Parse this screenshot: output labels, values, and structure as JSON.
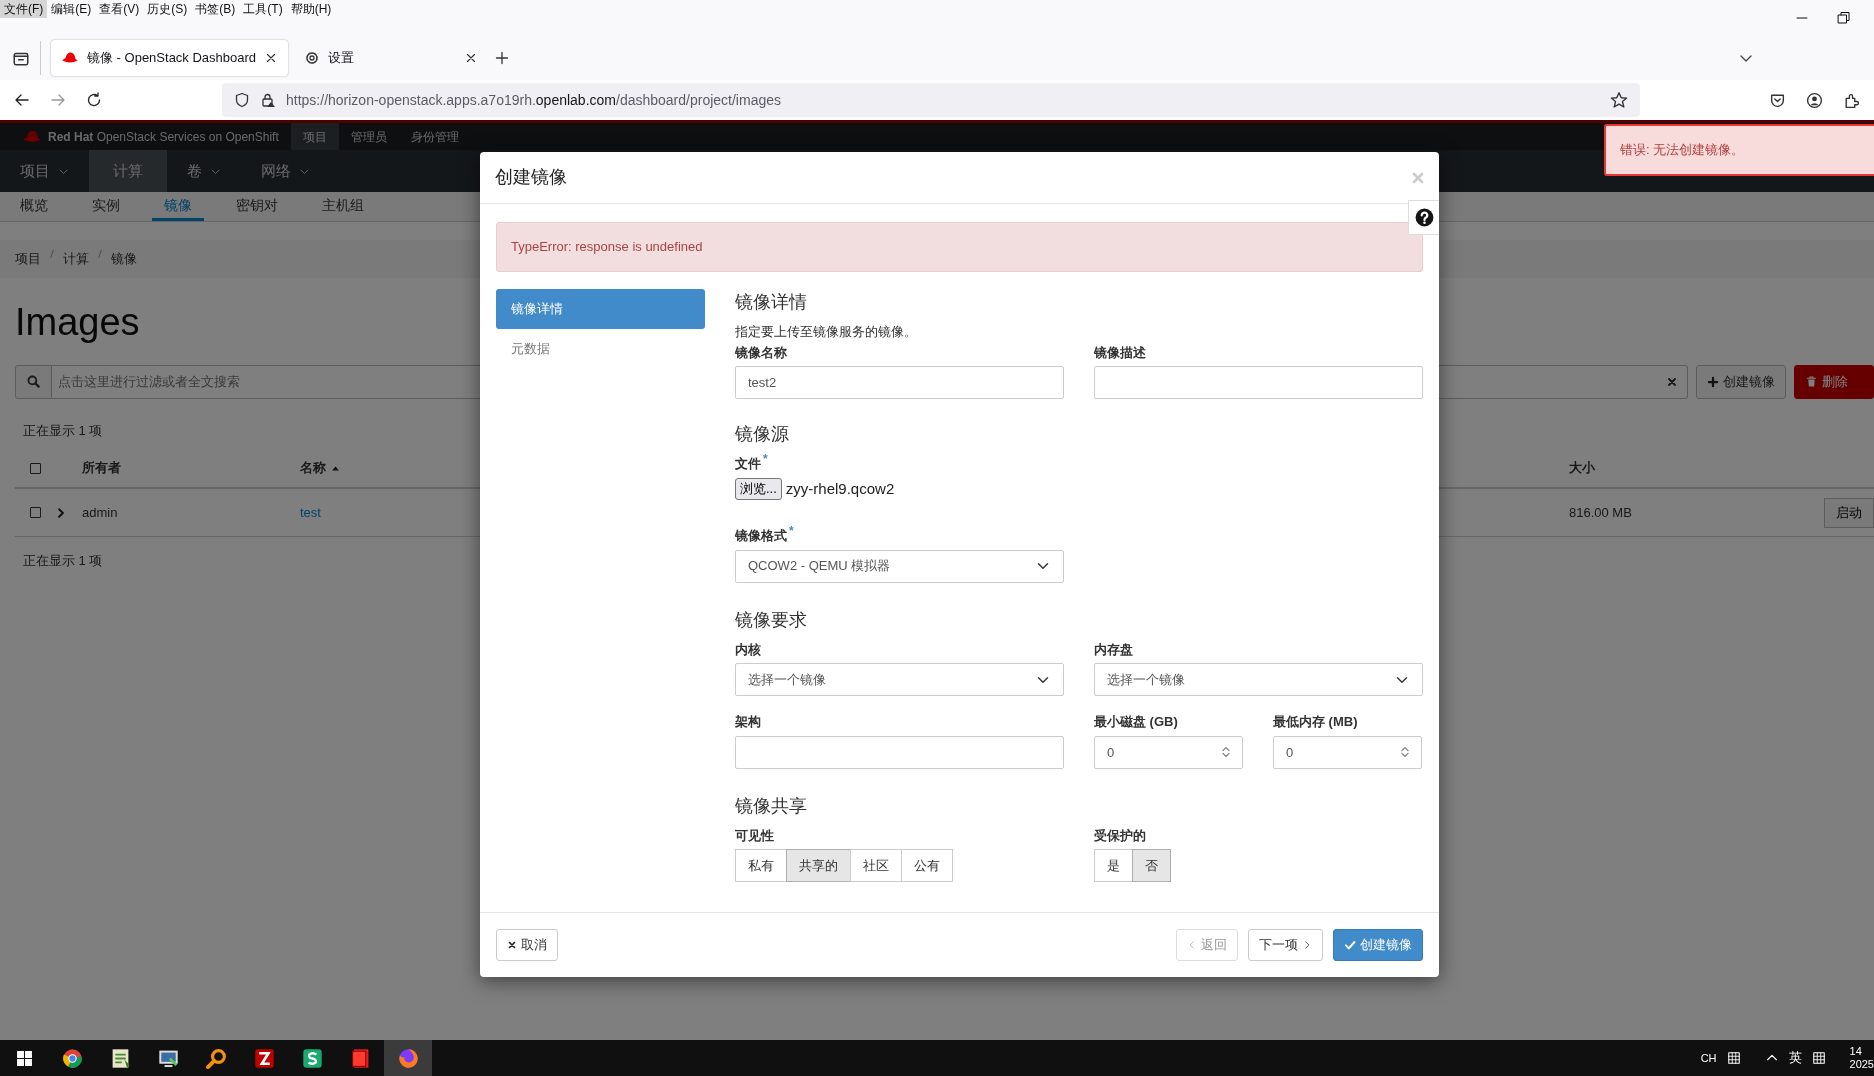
{
  "menu_bar": [
    {
      "label": "文件(F)",
      "selected": true
    },
    {
      "label": "编辑(E)",
      "selected": false
    },
    {
      "label": "查看(V)",
      "selected": false
    },
    {
      "label": "历史(S)",
      "selected": false
    },
    {
      "label": "书签(B)",
      "selected": false
    },
    {
      "label": "工具(T)",
      "selected": false
    },
    {
      "label": "帮助(H)",
      "selected": false
    }
  ],
  "browser_tabs": [
    {
      "kind": "site",
      "title": "镜像 - OpenStack Dashboard",
      "selected": true
    },
    {
      "kind": "settings",
      "title": "设置",
      "selected": false
    }
  ],
  "address": {
    "url_start": "https://horizon-openstack.apps.a7o19rh.",
    "url_domain": "openlab.com",
    "url_path": "/dashboard/project/images"
  },
  "brand": "**Red Hat** OpenStack Services on OpenShift",
  "top_nav": [
    {
      "label": "项目",
      "selected": true
    },
    {
      "label": "管理员",
      "selected": false
    },
    {
      "label": "身份管理",
      "selected": false
    }
  ],
  "section_nav": [
    {
      "label": "项目",
      "dropdown": true,
      "selected": false
    },
    {
      "label": "计算",
      "dropdown": false,
      "selected": true
    },
    {
      "label": "卷",
      "dropdown": true,
      "selected": false
    },
    {
      "label": "网络",
      "dropdown": true,
      "selected": false
    }
  ],
  "sub_nav": [
    {
      "label": "概览",
      "selected": false
    },
    {
      "label": "实例",
      "selected": false
    },
    {
      "label": "镜像",
      "selected": true
    },
    {
      "label": "密钥对",
      "selected": false
    },
    {
      "label": "主机组",
      "selected": false
    }
  ],
  "breadcrumb": [
    "项目",
    "计算",
    "镜像"
  ],
  "page_title": "Images",
  "filter": {
    "placeholder": "点击这里进行过滤或者全文搜索"
  },
  "actions": [
    {
      "kind": "create",
      "label": "创建镜像"
    },
    {
      "kind": "delete",
      "label": "删除"
    }
  ],
  "table": {
    "count_top": "正在显示 1 项",
    "select_all_checked": false,
    "columns": [
      {
        "label": "所有者",
        "sorted": false
      },
      {
        "label": "名称",
        "sorted": true
      },
      {
        "label": "大小",
        "sorted": false
      }
    ],
    "rows": [
      {
        "checked": false,
        "owner": "admin",
        "name": "test",
        "size": "816.00 MB",
        "action": "启动"
      }
    ],
    "count_bottom": "正在显示 1 项"
  },
  "toast": "错误: 无法创建镜像。",
  "modal": {
    "title": "创建镜像",
    "error": "TypeError: response is undefined",
    "steps": [
      {
        "label": "镜像详情",
        "selected": true
      },
      {
        "label": "元数据",
        "selected": false
      }
    ],
    "details": {
      "heading": "镜像详情",
      "description": "指定要上传至镜像服务的镜像。",
      "name_label": "镜像名称",
      "name_value": "test2",
      "desc_label": "镜像描述"
    },
    "source": {
      "heading": "镜像源",
      "file_label": "文件",
      "file_mark": "*",
      "browse": "浏览...",
      "file_name": "zyy-rhel9.qcow2",
      "format_label": "镜像格式",
      "format_mark": "*",
      "format_value": "QCOW2 - QEMU 模拟器"
    },
    "requirements": {
      "heading": "镜像要求",
      "kernel_label": "内核",
      "kernel_value": "选择一个镜像",
      "ramdisk_label": "内存盘",
      "ramdisk_value": "选择一个镜像",
      "arch_label": "架构",
      "disk_label": "最小磁盘 (GB)",
      "disk_value": "0",
      "ram_label": "最低内存 (MB)",
      "ram_value": "0"
    },
    "sharing": {
      "heading": "镜像共享",
      "visibility_label": "可见性",
      "visibility": [
        {
          "label": "私有",
          "selected": false
        },
        {
          "label": "共享的",
          "selected": true
        },
        {
          "label": "社区",
          "selected": false
        },
        {
          "label": "公有",
          "selected": false
        }
      ],
      "protected_label": "受保护的",
      "protected": [
        {
          "label": "是",
          "selected": false
        },
        {
          "label": "否",
          "selected": true
        }
      ]
    },
    "buttons": [
      {
        "kind": "cancel",
        "label": "取消",
        "disabled": false
      },
      {
        "kind": "back",
        "label": "返回",
        "disabled": true
      },
      {
        "kind": "next",
        "label": "下一项",
        "disabled": false
      },
      {
        "kind": "submit",
        "label": "创建镜像",
        "disabled": false
      }
    ]
  },
  "taskbar": {
    "apps": [
      {
        "kind": "round",
        "selected": false
      },
      {
        "kind": "notepad",
        "selected": false
      },
      {
        "kind": "monitor",
        "selected": false
      },
      {
        "kind": "magnifier",
        "selected": false
      },
      {
        "kind": "redtile",
        "selected": false
      },
      {
        "kind": "greentile",
        "selected": false
      },
      {
        "kind": "book",
        "selected": false
      },
      {
        "kind": "fox",
        "selected": true
      }
    ],
    "input_lang": "CH",
    "ime_mode": "英",
    "clock_time": "14",
    "clock_date": "2025"
  }
}
